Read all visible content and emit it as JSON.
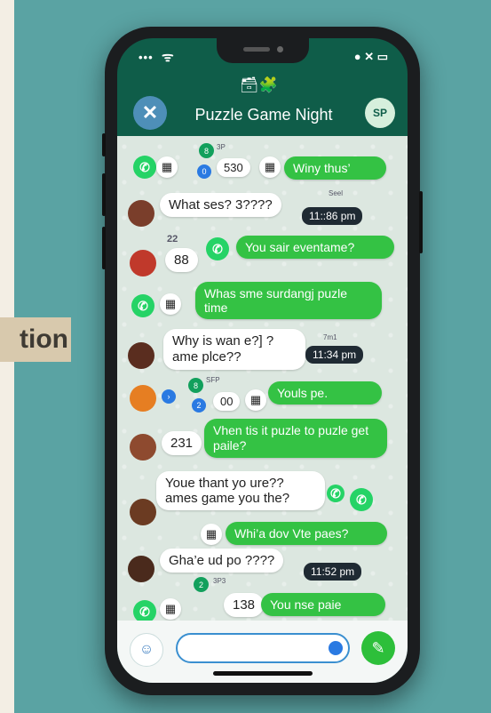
{
  "side_tag": "tion",
  "status_bar": {
    "dots": "•••",
    "wifi": "ᯤ",
    "right": "● ✕ ▭"
  },
  "header": {
    "title": "Puzzle Game Night",
    "avatar": "SP",
    "close_icon": "✕",
    "header_icons": "🗃🧩"
  },
  "messages": [
    {
      "id": "m1",
      "number": "530",
      "text": "Winy thus’",
      "meta": "3P"
    },
    {
      "id": "m2",
      "text": "What ses? 3????",
      "time": "11::86 pm",
      "meta": "Seel"
    },
    {
      "id": "m3",
      "number": "88",
      "text": "You sair eventame?",
      "meta": "22"
    },
    {
      "id": "m4",
      "text": "Whas sme surdangj puzle time"
    },
    {
      "id": "m5",
      "text": "Why is wan e?] ? ame plce??",
      "time": "11:34 pm",
      "meta": "7m1"
    },
    {
      "id": "m6",
      "number": "00",
      "text": "Youls pe.",
      "meta": "SFP"
    },
    {
      "id": "m7",
      "number": "231",
      "text": "Vhen tis it puzle to puzle get paile?"
    },
    {
      "id": "m8",
      "text": "Youe thant yo ure?? ames game you the?"
    },
    {
      "id": "m9",
      "text": "Whi’a dov Vte paes?"
    },
    {
      "id": "m10",
      "text": "Gha’e ud po ????",
      "time": "11:52 pm"
    },
    {
      "id": "m11",
      "number": "138",
      "text": "You nse paie",
      "meta": "3P3"
    }
  ],
  "composer": {
    "placeholder": "",
    "emoji_icon": "☺",
    "send_icon": "✎"
  },
  "colors": {
    "accent_green": "#34c244",
    "header_green": "#0f5d49",
    "bubble_white": "#ffffff",
    "time_dark": "#1f2a33"
  }
}
